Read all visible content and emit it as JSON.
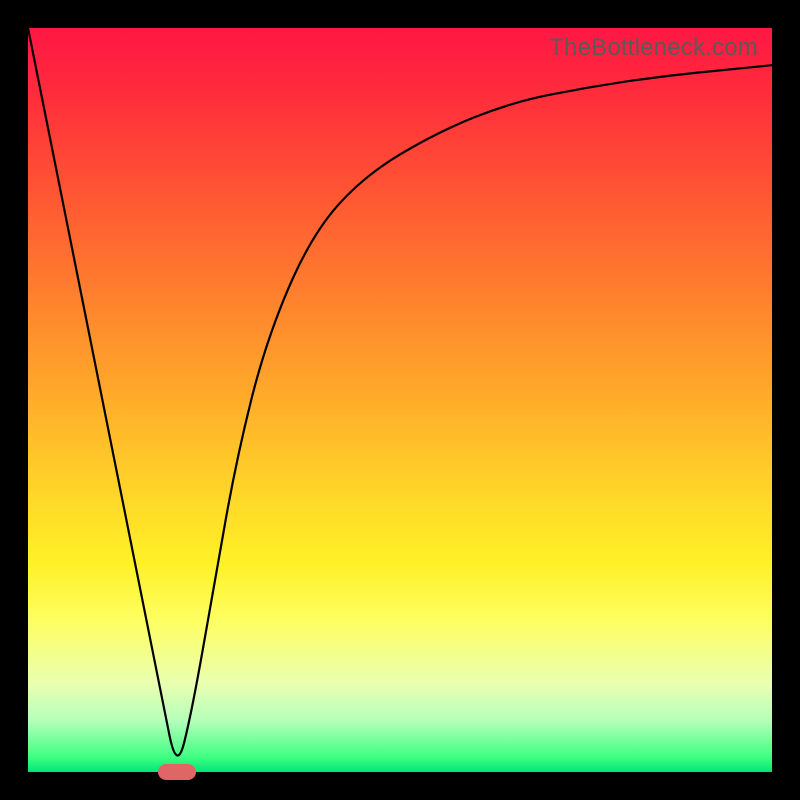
{
  "watermark": "TheBottleneck.com",
  "chart_data": {
    "type": "line",
    "title": "",
    "xlabel": "",
    "ylabel": "",
    "xlim": [
      0,
      100
    ],
    "ylim": [
      0,
      100
    ],
    "grid": false,
    "series": [
      {
        "name": "bottleneck-curve",
        "x": [
          0,
          5,
          10,
          15,
          18,
          20,
          22,
          25,
          28,
          32,
          38,
          45,
          55,
          65,
          75,
          85,
          95,
          100
        ],
        "y": [
          100,
          75,
          50,
          25,
          10,
          0,
          8,
          25,
          42,
          58,
          72,
          80,
          86,
          90,
          92,
          93.5,
          94.5,
          95
        ]
      }
    ],
    "marker": {
      "x": 20,
      "y": 0,
      "color": "#e06666"
    },
    "gradient_stops": [
      {
        "pos": 0,
        "color": "#ff1744"
      },
      {
        "pos": 22,
        "color": "#ff5533"
      },
      {
        "pos": 48,
        "color": "#ffa62a"
      },
      {
        "pos": 72,
        "color": "#fff128"
      },
      {
        "pos": 93,
        "color": "#b6ffba"
      },
      {
        "pos": 100,
        "color": "#00e676"
      }
    ]
  }
}
